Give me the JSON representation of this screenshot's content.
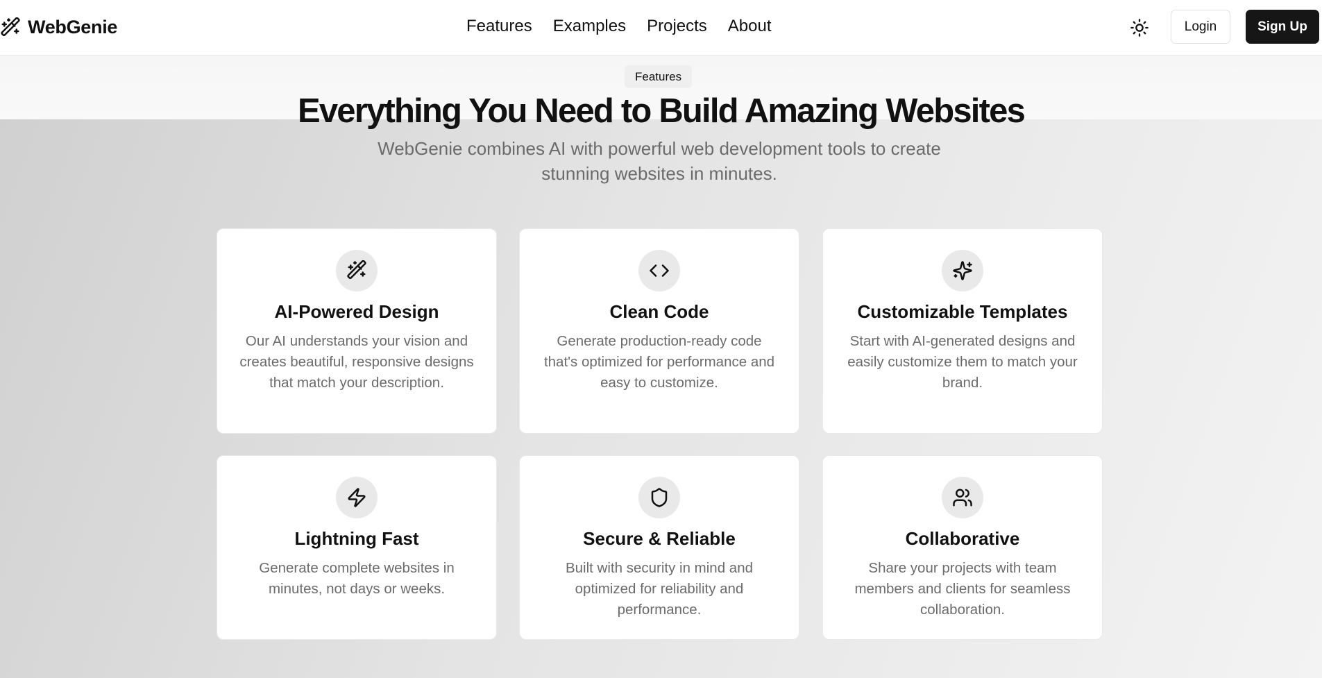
{
  "brand": {
    "name": "WebGenie",
    "icon": "magic-wand-icon"
  },
  "nav": {
    "items": [
      "Features",
      "Examples",
      "Projects",
      "About"
    ]
  },
  "header": {
    "theme_icon": "sun-icon",
    "login_label": "Login",
    "signup_label": "Sign Up"
  },
  "hero": {
    "badge": "Features",
    "title": "Everything You Need to Build Amazing Websites",
    "subtitle": "WebGenie combines AI with powerful web development tools to create stunning websites in minutes."
  },
  "features": [
    {
      "icon": "magic-wand-icon",
      "title": "AI-Powered Design",
      "description": "Our AI understands your vision and creates beautiful, responsive designs that match your description."
    },
    {
      "icon": "code-icon",
      "title": "Clean Code",
      "description": "Generate production-ready code that's optimized for performance and easy to customize."
    },
    {
      "icon": "sparkles-icon",
      "title": "Customizable Templates",
      "description": "Start with AI-generated designs and easily customize them to match your brand."
    },
    {
      "icon": "lightning-icon",
      "title": "Lightning Fast",
      "description": "Generate complete websites in minutes, not days or weeks."
    },
    {
      "icon": "shield-icon",
      "title": "Secure & Reliable",
      "description": "Built with security in mind and optimized for reliability and performance."
    },
    {
      "icon": "users-icon",
      "title": "Collaborative",
      "description": "Share your projects with team members and clients for seamless collaboration."
    }
  ],
  "colors": {
    "primary_button": "#161616",
    "muted_text": "#6b6b6b",
    "icon_bg": "#e9e9e9"
  }
}
